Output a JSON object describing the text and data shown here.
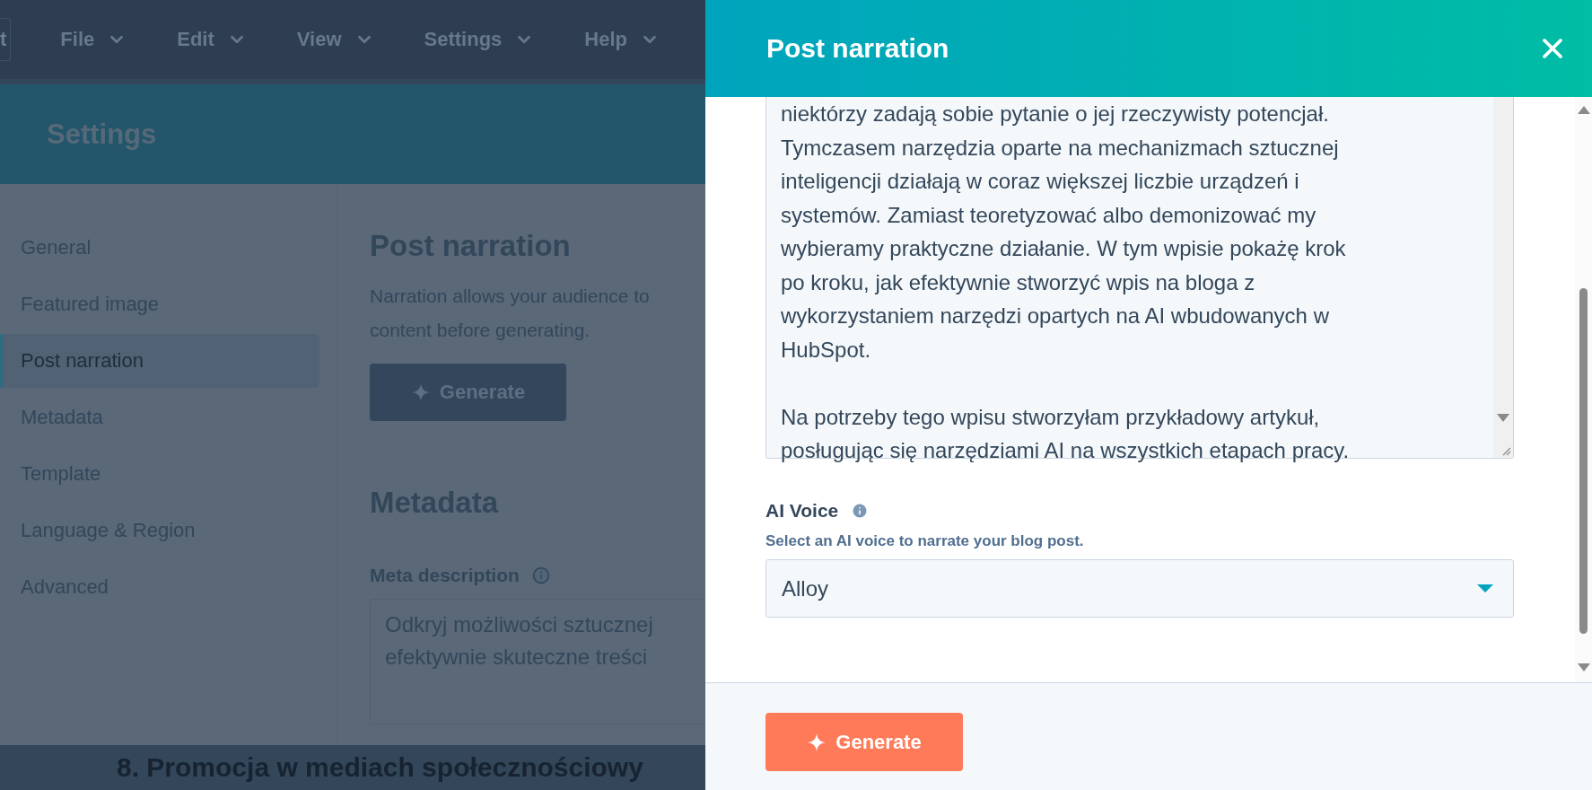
{
  "background_app": {
    "toolbar_button": "t",
    "menu": [
      {
        "label": "File"
      },
      {
        "label": "Edit"
      },
      {
        "label": "View"
      },
      {
        "label": "Settings"
      },
      {
        "label": "Help"
      }
    ],
    "banner_title": "Settings",
    "sidebar": {
      "items": [
        {
          "label": "General",
          "selected": false
        },
        {
          "label": "Featured image",
          "selected": false
        },
        {
          "label": "Post narration",
          "selected": true
        },
        {
          "label": "Metadata",
          "selected": false
        },
        {
          "label": "Template",
          "selected": false
        },
        {
          "label": "Language & Region",
          "selected": false
        },
        {
          "label": "Advanced",
          "selected": false
        }
      ]
    },
    "content": {
      "narration_heading": "Post narration",
      "narration_text": [
        "Narration allows your audience to",
        "content before generating."
      ],
      "generate_button": "Generate",
      "metadata_heading": "Metadata",
      "meta_description_label": "Meta description",
      "meta_description_value": [
        "Odkryj możliwości sztucznej",
        "efektywnie skuteczne treści"
      ]
    },
    "editor_heading": "8. Promocja w mediach społecznościowy"
  },
  "panel": {
    "title": "Post narration",
    "narration_text": [
      [
        "niektórzy zadają sobie pytanie o jej rzeczywisty potencjał.",
        "Tymczasem narzędzia oparte na mechanizmach sztucznej",
        "inteligencji działają w coraz większej liczbie urządzeń i",
        "systemów. Zamiast teoretyzować albo demonizować my",
        "wybieramy praktyczne działanie. W tym wpisie pokażę krok",
        "po kroku, jak efektywnie stworzyć wpis na bloga z",
        "wykorzystaniem narzędzi opartych na AI wbudowanych w",
        "HubSpot."
      ],
      [
        "Na potrzeby tego wpisu stworzyłam przykładowy artykuł,",
        "posługując się narzędziami AI na wszystkich etapach pracy."
      ]
    ],
    "voice_label": "AI Voice",
    "voice_help": "Select an AI voice to narrate your blog post.",
    "voice_value": "Alloy",
    "generate_button": "Generate"
  }
}
